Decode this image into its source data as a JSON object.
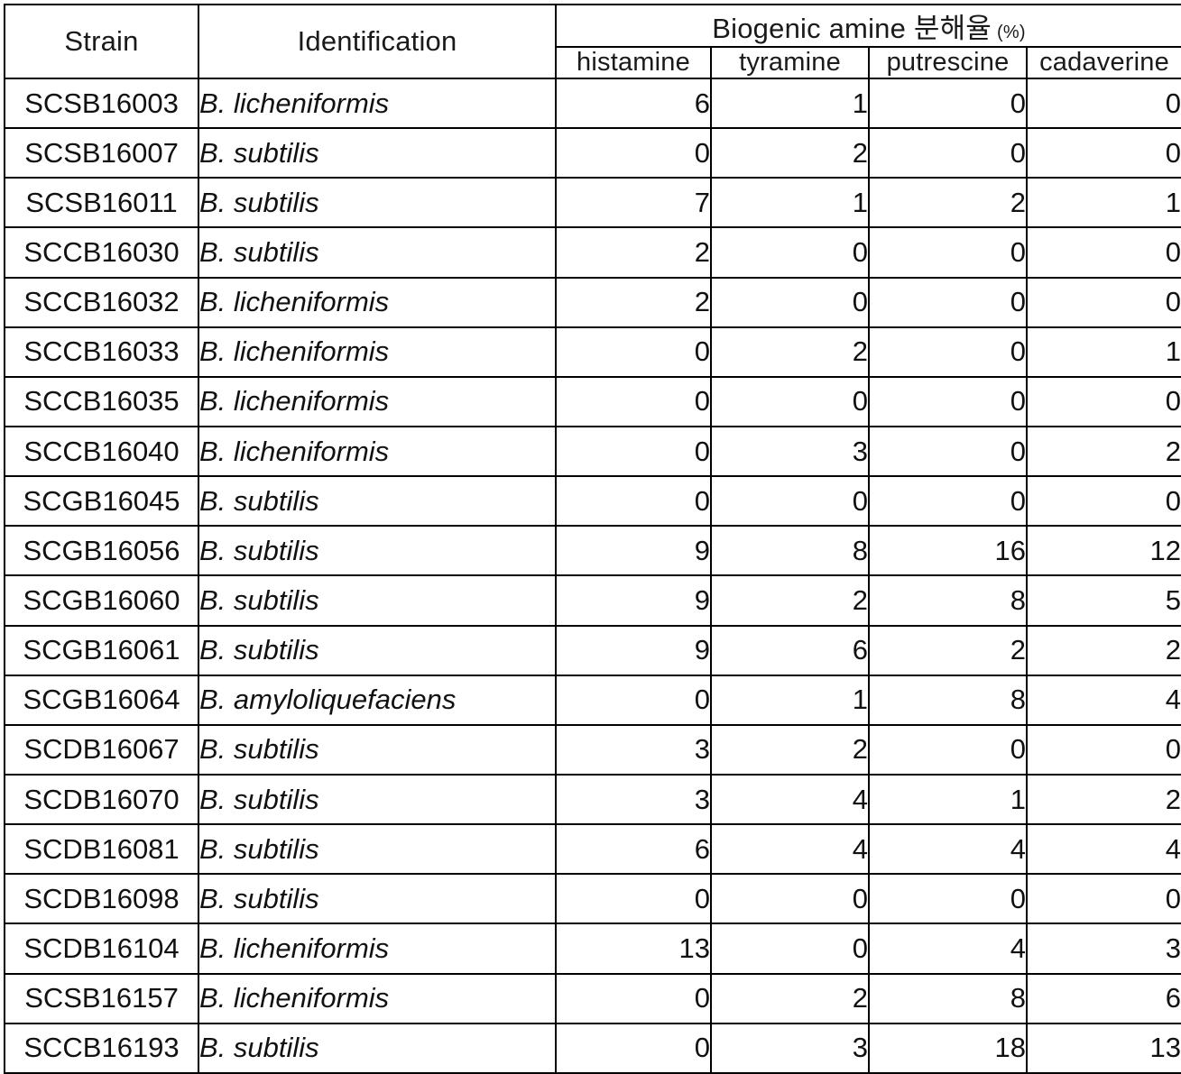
{
  "table": {
    "columns": {
      "strain": "Strain",
      "identification": "Identification",
      "group_header": "Biogenic amine 분해율",
      "group_header_unit": "(%)",
      "sub": [
        "histamine",
        "tyramine",
        "putrescine",
        "cadaverine"
      ]
    },
    "rows": [
      {
        "strain": "SCSB16003",
        "identification": "B. licheniformis",
        "histamine": "6",
        "tyramine": "1",
        "putrescine": "0",
        "cadaverine": "0"
      },
      {
        "strain": "SCSB16007",
        "identification": "B. subtilis",
        "histamine": "0",
        "tyramine": "2",
        "putrescine": "0",
        "cadaverine": "0"
      },
      {
        "strain": "SCSB16011",
        "identification": "B. subtilis",
        "histamine": "7",
        "tyramine": "1",
        "putrescine": "2",
        "cadaverine": "1"
      },
      {
        "strain": "SCCB16030",
        "identification": "B. subtilis",
        "histamine": "2",
        "tyramine": "0",
        "putrescine": "0",
        "cadaverine": "0"
      },
      {
        "strain": "SCCB16032",
        "identification": "B. licheniformis",
        "histamine": "2",
        "tyramine": "0",
        "putrescine": "0",
        "cadaverine": "0"
      },
      {
        "strain": "SCCB16033",
        "identification": "B. licheniformis",
        "histamine": "0",
        "tyramine": "2",
        "putrescine": "0",
        "cadaverine": "1"
      },
      {
        "strain": "SCCB16035",
        "identification": "B. licheniformis",
        "histamine": "0",
        "tyramine": "0",
        "putrescine": "0",
        "cadaverine": "0"
      },
      {
        "strain": "SCCB16040",
        "identification": "B. licheniformis",
        "histamine": "0",
        "tyramine": "3",
        "putrescine": "0",
        "cadaverine": "2"
      },
      {
        "strain": "SCGB16045",
        "identification": "B. subtilis",
        "histamine": "0",
        "tyramine": "0",
        "putrescine": "0",
        "cadaverine": "0"
      },
      {
        "strain": "SCGB16056",
        "identification": "B. subtilis",
        "histamine": "9",
        "tyramine": "8",
        "putrescine": "16",
        "cadaverine": "12"
      },
      {
        "strain": "SCGB16060",
        "identification": "B. subtilis",
        "histamine": "9",
        "tyramine": "2",
        "putrescine": "8",
        "cadaverine": "5"
      },
      {
        "strain": "SCGB16061",
        "identification": "B. subtilis",
        "histamine": "9",
        "tyramine": "6",
        "putrescine": "2",
        "cadaverine": "2"
      },
      {
        "strain": "SCGB16064",
        "identification": "B. amyloliquefaciens",
        "histamine": "0",
        "tyramine": "1",
        "putrescine": "8",
        "cadaverine": "4"
      },
      {
        "strain": "SCDB16067",
        "identification": "B. subtilis",
        "histamine": "3",
        "tyramine": "2",
        "putrescine": "0",
        "cadaverine": "0"
      },
      {
        "strain": "SCDB16070",
        "identification": "B. subtilis",
        "histamine": "3",
        "tyramine": "4",
        "putrescine": "1",
        "cadaverine": "2"
      },
      {
        "strain": "SCDB16081",
        "identification": "B. subtilis",
        "histamine": "6",
        "tyramine": "4",
        "putrescine": "4",
        "cadaverine": "4"
      },
      {
        "strain": "SCDB16098",
        "identification": "B. subtilis",
        "histamine": "0",
        "tyramine": "0",
        "putrescine": "0",
        "cadaverine": "0"
      },
      {
        "strain": "SCDB16104",
        "identification": "B. licheniformis",
        "histamine": "13",
        "tyramine": "0",
        "putrescine": "4",
        "cadaverine": "3"
      },
      {
        "strain": "SCSB16157",
        "identification": "B. licheniformis",
        "histamine": "0",
        "tyramine": "2",
        "putrescine": "8",
        "cadaverine": "6"
      },
      {
        "strain": "SCCB16193",
        "identification": "B. subtilis",
        "histamine": "0",
        "tyramine": "3",
        "putrescine": "18",
        "cadaverine": "13"
      }
    ]
  },
  "colors": {
    "header_fill": "#d9d9d9",
    "border": "#000000",
    "text": "#111111",
    "body_fill": "#ffffff"
  }
}
